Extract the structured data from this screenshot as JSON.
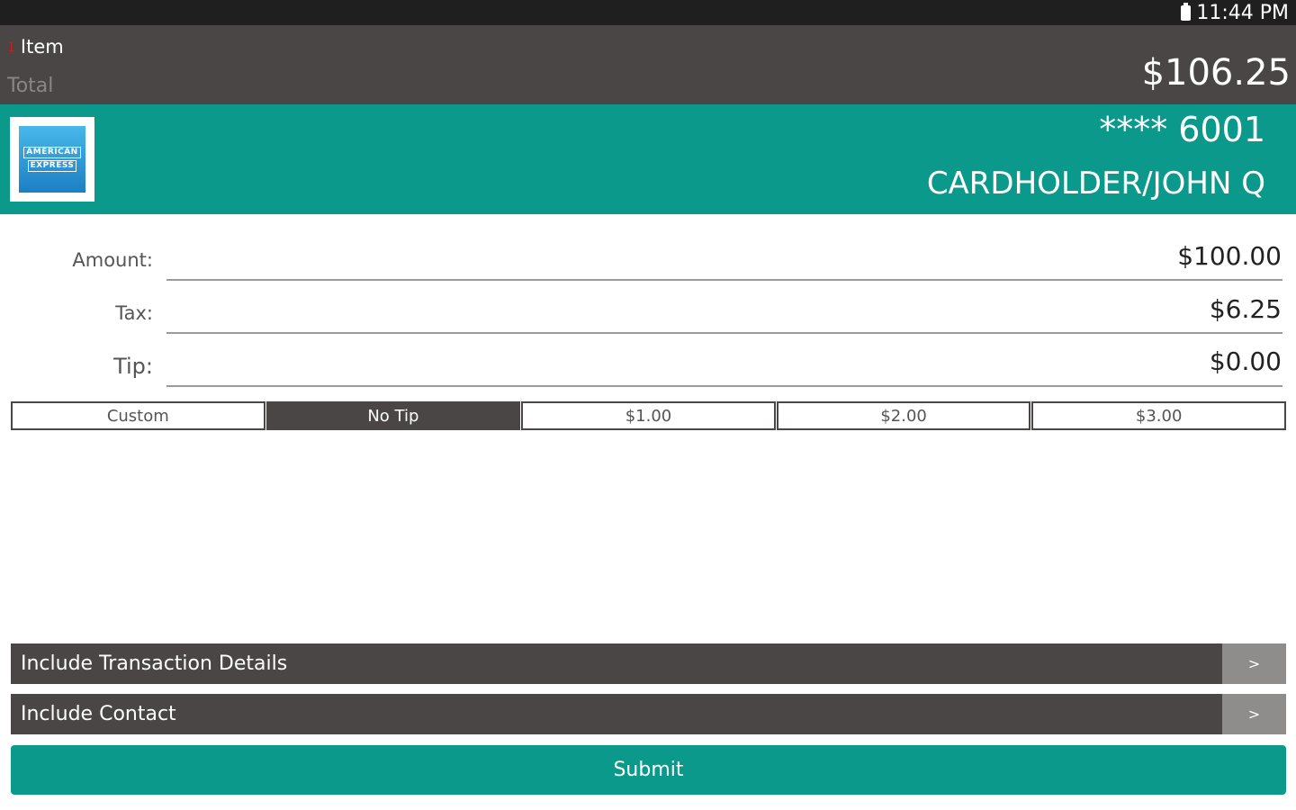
{
  "status_bar": {
    "time": "11:44 PM"
  },
  "summary": {
    "item_count": "1",
    "item_label": "Item",
    "total_label": "Total",
    "total_value": "$106.25"
  },
  "card": {
    "brand_line1": "AMERICAN",
    "brand_line2": "EXPRESS",
    "number": "**** 6001",
    "holder": "CARDHOLDER/JOHN Q"
  },
  "fields": {
    "amount_label": "Amount:",
    "amount_value": "$100.00",
    "tax_label": "Tax:",
    "tax_value": "$6.25",
    "tip_label": "Tip:",
    "tip_value": "$0.00"
  },
  "tip_options": [
    "Custom",
    "No Tip",
    "$1.00",
    "$2.00",
    "$3.00"
  ],
  "selected_tip": "No Tip",
  "options": {
    "transaction_details": "Include Transaction Details",
    "contact": "Include Contact",
    "arrow": ">"
  },
  "submit_label": "Submit"
}
